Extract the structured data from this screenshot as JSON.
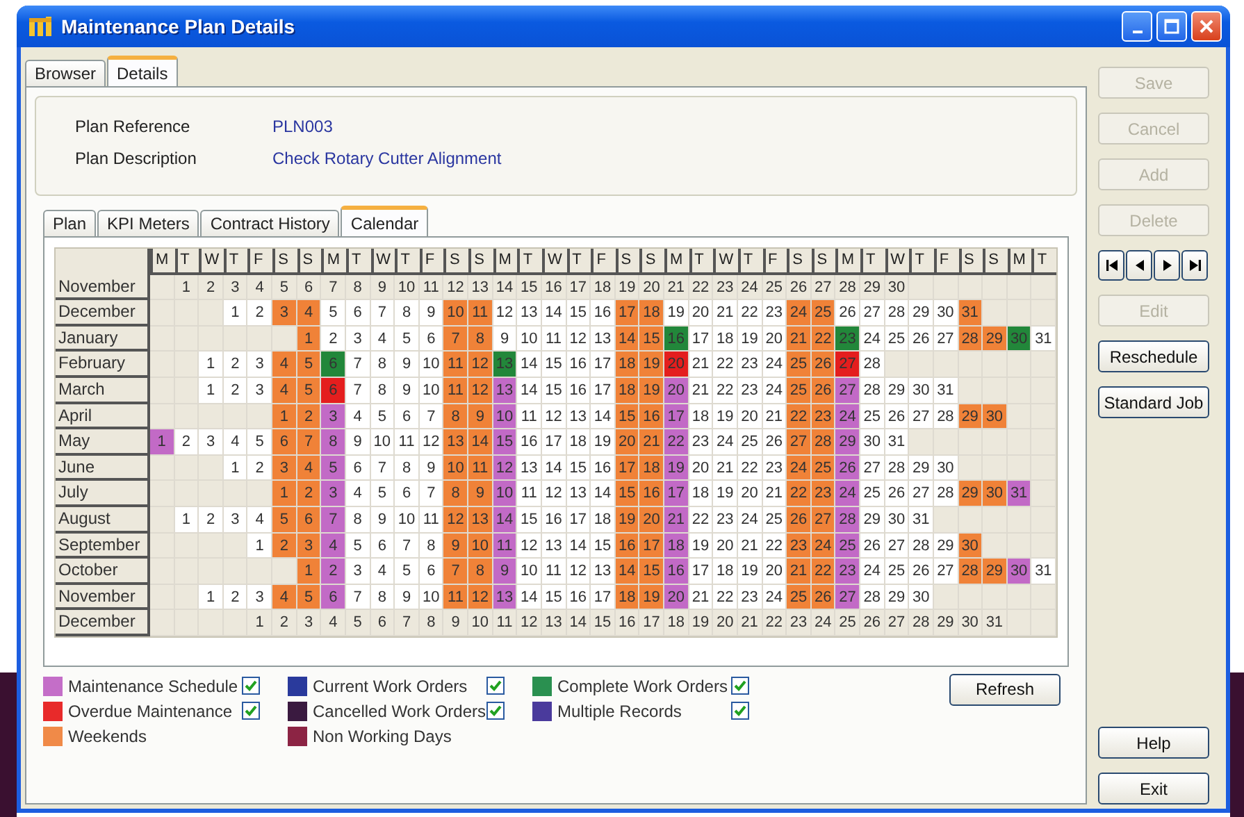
{
  "window": {
    "title": "Maintenance Plan Details"
  },
  "tabs": [
    {
      "label": "Browser",
      "selected": false
    },
    {
      "label": "Details",
      "selected": true
    }
  ],
  "fields": [
    {
      "label": "Plan Reference",
      "value": "PLN003"
    },
    {
      "label": "Plan Description",
      "value": "Check Rotary Cutter Alignment"
    }
  ],
  "sub_tabs": [
    {
      "label": "Plan",
      "selected": false
    },
    {
      "label": "KPI Meters",
      "selected": false
    },
    {
      "label": "Contract History",
      "selected": false
    },
    {
      "label": "Calendar",
      "selected": true
    }
  ],
  "calendar": {
    "weekday_headers": [
      "M",
      "T",
      "W",
      "T",
      "F",
      "S",
      "S",
      "M",
      "T",
      "W",
      "T",
      "F",
      "S",
      "S",
      "M",
      "T",
      "W",
      "T",
      "F",
      "S",
      "S",
      "M",
      "T",
      "W",
      "T",
      "F",
      "S",
      "S",
      "M",
      "T",
      "W",
      "T",
      "F",
      "S",
      "S",
      "M",
      "T"
    ],
    "months": [
      {
        "name": "November",
        "days": [
          {
            "kind": "blank"
          },
          {
            "day": "1",
            "kind": "off"
          },
          {
            "day": "2",
            "kind": "off"
          },
          {
            "day": "3",
            "kind": "off"
          },
          {
            "day": "4",
            "kind": "off"
          },
          {
            "day": "5",
            "kind": "off"
          },
          {
            "day": "6",
            "kind": "off"
          },
          {
            "day": "7",
            "kind": "off"
          },
          {
            "day": "8",
            "kind": "off"
          },
          {
            "day": "9",
            "kind": "off"
          },
          {
            "day": "10",
            "kind": "off"
          },
          {
            "day": "11",
            "kind": "off"
          },
          {
            "day": "12",
            "kind": "off"
          },
          {
            "day": "13",
            "kind": "off"
          },
          {
            "day": "14",
            "kind": "off"
          },
          {
            "day": "15",
            "kind": "off"
          },
          {
            "day": "16",
            "kind": "off"
          },
          {
            "day": "17",
            "kind": "off"
          },
          {
            "day": "18",
            "kind": "off"
          },
          {
            "day": "19",
            "kind": "off"
          },
          {
            "day": "20",
            "kind": "off"
          },
          {
            "day": "21",
            "kind": "off"
          },
          {
            "day": "22",
            "kind": "off"
          },
          {
            "day": "23",
            "kind": "off"
          },
          {
            "day": "24",
            "kind": "off"
          },
          {
            "day": "25",
            "kind": "off"
          },
          {
            "day": "26",
            "kind": "off"
          },
          {
            "day": "27",
            "kind": "off"
          },
          {
            "day": "28",
            "kind": "off"
          },
          {
            "day": "29",
            "kind": "off"
          },
          {
            "day": "30",
            "kind": "off"
          }
        ]
      },
      {
        "name": "December",
        "days": [
          {
            "kind": "blank"
          },
          {
            "kind": "blank"
          },
          {
            "kind": "blank"
          },
          {
            "day": "1",
            "kind": "plain"
          },
          {
            "day": "2",
            "kind": "plain"
          },
          {
            "day": "3",
            "kind": "weekend"
          },
          {
            "day": "4",
            "kind": "weekend"
          },
          {
            "day": "5",
            "kind": "plain"
          },
          {
            "day": "6",
            "kind": "plain"
          },
          {
            "day": "7",
            "kind": "plain"
          },
          {
            "day": "8",
            "kind": "plain"
          },
          {
            "day": "9",
            "kind": "plain"
          },
          {
            "day": "10",
            "kind": "weekend"
          },
          {
            "day": "11",
            "kind": "weekend"
          },
          {
            "day": "12",
            "kind": "plain"
          },
          {
            "day": "13",
            "kind": "plain"
          },
          {
            "day": "14",
            "kind": "plain"
          },
          {
            "day": "15",
            "kind": "plain"
          },
          {
            "day": "16",
            "kind": "plain"
          },
          {
            "day": "17",
            "kind": "weekend"
          },
          {
            "day": "18",
            "kind": "weekend"
          },
          {
            "day": "19",
            "kind": "plain"
          },
          {
            "day": "20",
            "kind": "plain"
          },
          {
            "day": "21",
            "kind": "plain"
          },
          {
            "day": "22",
            "kind": "plain"
          },
          {
            "day": "23",
            "kind": "plain"
          },
          {
            "day": "24",
            "kind": "weekend"
          },
          {
            "day": "25",
            "kind": "weekend"
          },
          {
            "day": "26",
            "kind": "plain"
          },
          {
            "day": "27",
            "kind": "plain"
          },
          {
            "day": "28",
            "kind": "plain"
          },
          {
            "day": "29",
            "kind": "plain"
          },
          {
            "day": "30",
            "kind": "plain"
          },
          {
            "day": "31",
            "kind": "weekend"
          }
        ]
      },
      {
        "name": "January",
        "days": [
          {
            "kind": "blank"
          },
          {
            "kind": "blank"
          },
          {
            "kind": "blank"
          },
          {
            "kind": "blank"
          },
          {
            "kind": "blank"
          },
          {
            "kind": "blank"
          },
          {
            "day": "1",
            "kind": "weekend"
          },
          {
            "day": "2",
            "kind": "plain"
          },
          {
            "day": "3",
            "kind": "plain"
          },
          {
            "day": "4",
            "kind": "plain"
          },
          {
            "day": "5",
            "kind": "plain"
          },
          {
            "day": "6",
            "kind": "plain"
          },
          {
            "day": "7",
            "kind": "weekend"
          },
          {
            "day": "8",
            "kind": "weekend"
          },
          {
            "day": "9",
            "kind": "plain"
          },
          {
            "day": "10",
            "kind": "plain"
          },
          {
            "day": "11",
            "kind": "plain"
          },
          {
            "day": "12",
            "kind": "plain"
          },
          {
            "day": "13",
            "kind": "plain"
          },
          {
            "day": "14",
            "kind": "weekend"
          },
          {
            "day": "15",
            "kind": "weekend"
          },
          {
            "day": "16",
            "kind": "complete"
          },
          {
            "day": "17",
            "kind": "plain"
          },
          {
            "day": "18",
            "kind": "plain"
          },
          {
            "day": "19",
            "kind": "plain"
          },
          {
            "day": "20",
            "kind": "plain"
          },
          {
            "day": "21",
            "kind": "weekend"
          },
          {
            "day": "22",
            "kind": "weekend"
          },
          {
            "day": "23",
            "kind": "complete"
          },
          {
            "day": "24",
            "kind": "plain"
          },
          {
            "day": "25",
            "kind": "plain"
          },
          {
            "day": "26",
            "kind": "plain"
          },
          {
            "day": "27",
            "kind": "plain"
          },
          {
            "day": "28",
            "kind": "weekend"
          },
          {
            "day": "29",
            "kind": "weekend"
          },
          {
            "day": "30",
            "kind": "complete"
          },
          {
            "day": "31",
            "kind": "plain"
          }
        ]
      },
      {
        "name": "February",
        "days": [
          {
            "kind": "blank"
          },
          {
            "kind": "blank"
          },
          {
            "day": "1",
            "kind": "plain"
          },
          {
            "day": "2",
            "kind": "plain"
          },
          {
            "day": "3",
            "kind": "plain"
          },
          {
            "day": "4",
            "kind": "weekend"
          },
          {
            "day": "5",
            "kind": "weekend"
          },
          {
            "day": "6",
            "kind": "complete"
          },
          {
            "day": "7",
            "kind": "plain"
          },
          {
            "day": "8",
            "kind": "plain"
          },
          {
            "day": "9",
            "kind": "plain"
          },
          {
            "day": "10",
            "kind": "plain"
          },
          {
            "day": "11",
            "kind": "weekend"
          },
          {
            "day": "12",
            "kind": "weekend"
          },
          {
            "day": "13",
            "kind": "complete"
          },
          {
            "day": "14",
            "kind": "plain"
          },
          {
            "day": "15",
            "kind": "plain"
          },
          {
            "day": "16",
            "kind": "plain"
          },
          {
            "day": "17",
            "kind": "plain"
          },
          {
            "day": "18",
            "kind": "weekend"
          },
          {
            "day": "19",
            "kind": "weekend"
          },
          {
            "day": "20",
            "kind": "overdue"
          },
          {
            "day": "21",
            "kind": "plain"
          },
          {
            "day": "22",
            "kind": "plain"
          },
          {
            "day": "23",
            "kind": "plain"
          },
          {
            "day": "24",
            "kind": "plain"
          },
          {
            "day": "25",
            "kind": "weekend"
          },
          {
            "day": "26",
            "kind": "weekend"
          },
          {
            "day": "27",
            "kind": "overdue"
          },
          {
            "day": "28",
            "kind": "plain"
          }
        ]
      },
      {
        "name": "March",
        "days": [
          {
            "kind": "blank"
          },
          {
            "kind": "blank"
          },
          {
            "day": "1",
            "kind": "plain"
          },
          {
            "day": "2",
            "kind": "plain"
          },
          {
            "day": "3",
            "kind": "plain"
          },
          {
            "day": "4",
            "kind": "weekend"
          },
          {
            "day": "5",
            "kind": "weekend"
          },
          {
            "day": "6",
            "kind": "overdue"
          },
          {
            "day": "7",
            "kind": "plain"
          },
          {
            "day": "8",
            "kind": "plain"
          },
          {
            "day": "9",
            "kind": "plain"
          },
          {
            "day": "10",
            "kind": "plain"
          },
          {
            "day": "11",
            "kind": "weekend"
          },
          {
            "day": "12",
            "kind": "weekend"
          },
          {
            "day": "13",
            "kind": "schedule"
          },
          {
            "day": "14",
            "kind": "plain"
          },
          {
            "day": "15",
            "kind": "plain"
          },
          {
            "day": "16",
            "kind": "plain"
          },
          {
            "day": "17",
            "kind": "plain"
          },
          {
            "day": "18",
            "kind": "weekend"
          },
          {
            "day": "19",
            "kind": "weekend"
          },
          {
            "day": "20",
            "kind": "schedule"
          },
          {
            "day": "21",
            "kind": "plain"
          },
          {
            "day": "22",
            "kind": "plain"
          },
          {
            "day": "23",
            "kind": "plain"
          },
          {
            "day": "24",
            "kind": "plain"
          },
          {
            "day": "25",
            "kind": "weekend"
          },
          {
            "day": "26",
            "kind": "weekend"
          },
          {
            "day": "27",
            "kind": "schedule"
          },
          {
            "day": "28",
            "kind": "plain"
          },
          {
            "day": "29",
            "kind": "plain"
          },
          {
            "day": "30",
            "kind": "plain"
          },
          {
            "day": "31",
            "kind": "plain"
          }
        ]
      },
      {
        "name": "April",
        "days": [
          {
            "kind": "blank"
          },
          {
            "kind": "blank"
          },
          {
            "kind": "blank"
          },
          {
            "kind": "blank"
          },
          {
            "kind": "blank"
          },
          {
            "day": "1",
            "kind": "weekend"
          },
          {
            "day": "2",
            "kind": "weekend"
          },
          {
            "day": "3",
            "kind": "schedule"
          },
          {
            "day": "4",
            "kind": "plain"
          },
          {
            "day": "5",
            "kind": "plain"
          },
          {
            "day": "6",
            "kind": "plain"
          },
          {
            "day": "7",
            "kind": "plain"
          },
          {
            "day": "8",
            "kind": "weekend"
          },
          {
            "day": "9",
            "kind": "weekend"
          },
          {
            "day": "10",
            "kind": "schedule"
          },
          {
            "day": "11",
            "kind": "plain"
          },
          {
            "day": "12",
            "kind": "plain"
          },
          {
            "day": "13",
            "kind": "plain"
          },
          {
            "day": "14",
            "kind": "plain"
          },
          {
            "day": "15",
            "kind": "weekend"
          },
          {
            "day": "16",
            "kind": "weekend"
          },
          {
            "day": "17",
            "kind": "schedule"
          },
          {
            "day": "18",
            "kind": "plain"
          },
          {
            "day": "19",
            "kind": "plain"
          },
          {
            "day": "20",
            "kind": "plain"
          },
          {
            "day": "21",
            "kind": "plain"
          },
          {
            "day": "22",
            "kind": "weekend"
          },
          {
            "day": "23",
            "kind": "weekend"
          },
          {
            "day": "24",
            "kind": "schedule"
          },
          {
            "day": "25",
            "kind": "plain"
          },
          {
            "day": "26",
            "kind": "plain"
          },
          {
            "day": "27",
            "kind": "plain"
          },
          {
            "day": "28",
            "kind": "plain"
          },
          {
            "day": "29",
            "kind": "weekend"
          },
          {
            "day": "30",
            "kind": "weekend"
          }
        ]
      },
      {
        "name": "May",
        "days": [
          {
            "day": "1",
            "kind": "schedule"
          },
          {
            "day": "2",
            "kind": "plain"
          },
          {
            "day": "3",
            "kind": "plain"
          },
          {
            "day": "4",
            "kind": "plain"
          },
          {
            "day": "5",
            "kind": "plain"
          },
          {
            "day": "6",
            "kind": "weekend"
          },
          {
            "day": "7",
            "kind": "weekend"
          },
          {
            "day": "8",
            "kind": "schedule"
          },
          {
            "day": "9",
            "kind": "plain"
          },
          {
            "day": "10",
            "kind": "plain"
          },
          {
            "day": "11",
            "kind": "plain"
          },
          {
            "day": "12",
            "kind": "plain"
          },
          {
            "day": "13",
            "kind": "weekend"
          },
          {
            "day": "14",
            "kind": "weekend"
          },
          {
            "day": "15",
            "kind": "schedule"
          },
          {
            "day": "16",
            "kind": "plain"
          },
          {
            "day": "17",
            "kind": "plain"
          },
          {
            "day": "18",
            "kind": "plain"
          },
          {
            "day": "19",
            "kind": "plain"
          },
          {
            "day": "20",
            "kind": "weekend"
          },
          {
            "day": "21",
            "kind": "weekend"
          },
          {
            "day": "22",
            "kind": "schedule"
          },
          {
            "day": "23",
            "kind": "plain"
          },
          {
            "day": "24",
            "kind": "plain"
          },
          {
            "day": "25",
            "kind": "plain"
          },
          {
            "day": "26",
            "kind": "plain"
          },
          {
            "day": "27",
            "kind": "weekend"
          },
          {
            "day": "28",
            "kind": "weekend"
          },
          {
            "day": "29",
            "kind": "schedule"
          },
          {
            "day": "30",
            "kind": "plain"
          },
          {
            "day": "31",
            "kind": "plain"
          }
        ]
      },
      {
        "name": "June",
        "days": [
          {
            "kind": "blank"
          },
          {
            "kind": "blank"
          },
          {
            "kind": "blank"
          },
          {
            "day": "1",
            "kind": "plain"
          },
          {
            "day": "2",
            "kind": "plain"
          },
          {
            "day": "3",
            "kind": "weekend"
          },
          {
            "day": "4",
            "kind": "weekend"
          },
          {
            "day": "5",
            "kind": "schedule"
          },
          {
            "day": "6",
            "kind": "plain"
          },
          {
            "day": "7",
            "kind": "plain"
          },
          {
            "day": "8",
            "kind": "plain"
          },
          {
            "day": "9",
            "kind": "plain"
          },
          {
            "day": "10",
            "kind": "weekend"
          },
          {
            "day": "11",
            "kind": "weekend"
          },
          {
            "day": "12",
            "kind": "schedule"
          },
          {
            "day": "13",
            "kind": "plain"
          },
          {
            "day": "14",
            "kind": "plain"
          },
          {
            "day": "15",
            "kind": "plain"
          },
          {
            "day": "16",
            "kind": "plain"
          },
          {
            "day": "17",
            "kind": "weekend"
          },
          {
            "day": "18",
            "kind": "weekend"
          },
          {
            "day": "19",
            "kind": "schedule"
          },
          {
            "day": "20",
            "kind": "plain"
          },
          {
            "day": "21",
            "kind": "plain"
          },
          {
            "day": "22",
            "kind": "plain"
          },
          {
            "day": "23",
            "kind": "plain"
          },
          {
            "day": "24",
            "kind": "weekend"
          },
          {
            "day": "25",
            "kind": "weekend"
          },
          {
            "day": "26",
            "kind": "schedule"
          },
          {
            "day": "27",
            "kind": "plain"
          },
          {
            "day": "28",
            "kind": "plain"
          },
          {
            "day": "29",
            "kind": "plain"
          },
          {
            "day": "30",
            "kind": "plain"
          }
        ]
      },
      {
        "name": "July",
        "days": [
          {
            "kind": "blank"
          },
          {
            "kind": "blank"
          },
          {
            "kind": "blank"
          },
          {
            "kind": "blank"
          },
          {
            "kind": "blank"
          },
          {
            "day": "1",
            "kind": "weekend"
          },
          {
            "day": "2",
            "kind": "weekend"
          },
          {
            "day": "3",
            "kind": "schedule"
          },
          {
            "day": "4",
            "kind": "plain"
          },
          {
            "day": "5",
            "kind": "plain"
          },
          {
            "day": "6",
            "kind": "plain"
          },
          {
            "day": "7",
            "kind": "plain"
          },
          {
            "day": "8",
            "kind": "weekend"
          },
          {
            "day": "9",
            "kind": "weekend"
          },
          {
            "day": "10",
            "kind": "schedule"
          },
          {
            "day": "11",
            "kind": "plain"
          },
          {
            "day": "12",
            "kind": "plain"
          },
          {
            "day": "13",
            "kind": "plain"
          },
          {
            "day": "14",
            "kind": "plain"
          },
          {
            "day": "15",
            "kind": "weekend"
          },
          {
            "day": "16",
            "kind": "weekend"
          },
          {
            "day": "17",
            "kind": "schedule"
          },
          {
            "day": "18",
            "kind": "plain"
          },
          {
            "day": "19",
            "kind": "plain"
          },
          {
            "day": "20",
            "kind": "plain"
          },
          {
            "day": "21",
            "kind": "plain"
          },
          {
            "day": "22",
            "kind": "weekend"
          },
          {
            "day": "23",
            "kind": "weekend"
          },
          {
            "day": "24",
            "kind": "schedule"
          },
          {
            "day": "25",
            "kind": "plain"
          },
          {
            "day": "26",
            "kind": "plain"
          },
          {
            "day": "27",
            "kind": "plain"
          },
          {
            "day": "28",
            "kind": "plain"
          },
          {
            "day": "29",
            "kind": "weekend"
          },
          {
            "day": "30",
            "kind": "weekend"
          },
          {
            "day": "31",
            "kind": "schedule"
          }
        ]
      },
      {
        "name": "August",
        "days": [
          {
            "kind": "blank"
          },
          {
            "day": "1",
            "kind": "plain"
          },
          {
            "day": "2",
            "kind": "plain"
          },
          {
            "day": "3",
            "kind": "plain"
          },
          {
            "day": "4",
            "kind": "plain"
          },
          {
            "day": "5",
            "kind": "weekend"
          },
          {
            "day": "6",
            "kind": "weekend"
          },
          {
            "day": "7",
            "kind": "schedule"
          },
          {
            "day": "8",
            "kind": "plain"
          },
          {
            "day": "9",
            "kind": "plain"
          },
          {
            "day": "10",
            "kind": "plain"
          },
          {
            "day": "11",
            "kind": "plain"
          },
          {
            "day": "12",
            "kind": "weekend"
          },
          {
            "day": "13",
            "kind": "weekend"
          },
          {
            "day": "14",
            "kind": "schedule"
          },
          {
            "day": "15",
            "kind": "plain"
          },
          {
            "day": "16",
            "kind": "plain"
          },
          {
            "day": "17",
            "kind": "plain"
          },
          {
            "day": "18",
            "kind": "plain"
          },
          {
            "day": "19",
            "kind": "weekend"
          },
          {
            "day": "20",
            "kind": "weekend"
          },
          {
            "day": "21",
            "kind": "schedule"
          },
          {
            "day": "22",
            "kind": "plain"
          },
          {
            "day": "23",
            "kind": "plain"
          },
          {
            "day": "24",
            "kind": "plain"
          },
          {
            "day": "25",
            "kind": "plain"
          },
          {
            "day": "26",
            "kind": "weekend"
          },
          {
            "day": "27",
            "kind": "weekend"
          },
          {
            "day": "28",
            "kind": "schedule"
          },
          {
            "day": "29",
            "kind": "plain"
          },
          {
            "day": "30",
            "kind": "plain"
          },
          {
            "day": "31",
            "kind": "plain"
          }
        ]
      },
      {
        "name": "September",
        "days": [
          {
            "kind": "blank"
          },
          {
            "kind": "blank"
          },
          {
            "kind": "blank"
          },
          {
            "kind": "blank"
          },
          {
            "day": "1",
            "kind": "plain"
          },
          {
            "day": "2",
            "kind": "weekend"
          },
          {
            "day": "3",
            "kind": "weekend"
          },
          {
            "day": "4",
            "kind": "schedule"
          },
          {
            "day": "5",
            "kind": "plain"
          },
          {
            "day": "6",
            "kind": "plain"
          },
          {
            "day": "7",
            "kind": "plain"
          },
          {
            "day": "8",
            "kind": "plain"
          },
          {
            "day": "9",
            "kind": "weekend"
          },
          {
            "day": "10",
            "kind": "weekend"
          },
          {
            "day": "11",
            "kind": "schedule"
          },
          {
            "day": "12",
            "kind": "plain"
          },
          {
            "day": "13",
            "kind": "plain"
          },
          {
            "day": "14",
            "kind": "plain"
          },
          {
            "day": "15",
            "kind": "plain"
          },
          {
            "day": "16",
            "kind": "weekend"
          },
          {
            "day": "17",
            "kind": "weekend"
          },
          {
            "day": "18",
            "kind": "schedule"
          },
          {
            "day": "19",
            "kind": "plain"
          },
          {
            "day": "20",
            "kind": "plain"
          },
          {
            "day": "21",
            "kind": "plain"
          },
          {
            "day": "22",
            "kind": "plain"
          },
          {
            "day": "23",
            "kind": "weekend"
          },
          {
            "day": "24",
            "kind": "weekend"
          },
          {
            "day": "25",
            "kind": "schedule"
          },
          {
            "day": "26",
            "kind": "plain"
          },
          {
            "day": "27",
            "kind": "plain"
          },
          {
            "day": "28",
            "kind": "plain"
          },
          {
            "day": "29",
            "kind": "plain"
          },
          {
            "day": "30",
            "kind": "weekend"
          }
        ]
      },
      {
        "name": "October",
        "days": [
          {
            "kind": "blank"
          },
          {
            "kind": "blank"
          },
          {
            "kind": "blank"
          },
          {
            "kind": "blank"
          },
          {
            "kind": "blank"
          },
          {
            "kind": "blank"
          },
          {
            "day": "1",
            "kind": "weekend"
          },
          {
            "day": "2",
            "kind": "schedule"
          },
          {
            "day": "3",
            "kind": "plain"
          },
          {
            "day": "4",
            "kind": "plain"
          },
          {
            "day": "5",
            "kind": "plain"
          },
          {
            "day": "6",
            "kind": "plain"
          },
          {
            "day": "7",
            "kind": "weekend"
          },
          {
            "day": "8",
            "kind": "weekend"
          },
          {
            "day": "9",
            "kind": "schedule"
          },
          {
            "day": "10",
            "kind": "plain"
          },
          {
            "day": "11",
            "kind": "plain"
          },
          {
            "day": "12",
            "kind": "plain"
          },
          {
            "day": "13",
            "kind": "plain"
          },
          {
            "day": "14",
            "kind": "weekend"
          },
          {
            "day": "15",
            "kind": "weekend"
          },
          {
            "day": "16",
            "kind": "schedule"
          },
          {
            "day": "17",
            "kind": "plain"
          },
          {
            "day": "18",
            "kind": "plain"
          },
          {
            "day": "19",
            "kind": "plain"
          },
          {
            "day": "20",
            "kind": "plain"
          },
          {
            "day": "21",
            "kind": "weekend"
          },
          {
            "day": "22",
            "kind": "weekend"
          },
          {
            "day": "23",
            "kind": "schedule"
          },
          {
            "day": "24",
            "kind": "plain"
          },
          {
            "day": "25",
            "kind": "plain"
          },
          {
            "day": "26",
            "kind": "plain"
          },
          {
            "day": "27",
            "kind": "plain"
          },
          {
            "day": "28",
            "kind": "weekend"
          },
          {
            "day": "29",
            "kind": "weekend"
          },
          {
            "day": "30",
            "kind": "schedule"
          },
          {
            "day": "31",
            "kind": "plain"
          }
        ]
      },
      {
        "name": "November",
        "days": [
          {
            "kind": "blank"
          },
          {
            "kind": "blank"
          },
          {
            "day": "1",
            "kind": "plain"
          },
          {
            "day": "2",
            "kind": "plain"
          },
          {
            "day": "3",
            "kind": "plain"
          },
          {
            "day": "4",
            "kind": "weekend"
          },
          {
            "day": "5",
            "kind": "weekend"
          },
          {
            "day": "6",
            "kind": "schedule"
          },
          {
            "day": "7",
            "kind": "plain"
          },
          {
            "day": "8",
            "kind": "plain"
          },
          {
            "day": "9",
            "kind": "plain"
          },
          {
            "day": "10",
            "kind": "plain"
          },
          {
            "day": "11",
            "kind": "weekend"
          },
          {
            "day": "12",
            "kind": "weekend"
          },
          {
            "day": "13",
            "kind": "schedule"
          },
          {
            "day": "14",
            "kind": "plain"
          },
          {
            "day": "15",
            "kind": "plain"
          },
          {
            "day": "16",
            "kind": "plain"
          },
          {
            "day": "17",
            "kind": "plain"
          },
          {
            "day": "18",
            "kind": "weekend"
          },
          {
            "day": "19",
            "kind": "weekend"
          },
          {
            "day": "20",
            "kind": "schedule"
          },
          {
            "day": "21",
            "kind": "plain"
          },
          {
            "day": "22",
            "kind": "plain"
          },
          {
            "day": "23",
            "kind": "plain"
          },
          {
            "day": "24",
            "kind": "plain"
          },
          {
            "day": "25",
            "kind": "weekend"
          },
          {
            "day": "26",
            "kind": "weekend"
          },
          {
            "day": "27",
            "kind": "schedule"
          },
          {
            "day": "28",
            "kind": "plain"
          },
          {
            "day": "29",
            "kind": "plain"
          },
          {
            "day": "30",
            "kind": "plain"
          }
        ]
      },
      {
        "name": "December",
        "days": [
          {
            "kind": "blank"
          },
          {
            "kind": "blank"
          },
          {
            "kind": "blank"
          },
          {
            "kind": "blank"
          },
          {
            "day": "1",
            "kind": "off"
          },
          {
            "day": "2",
            "kind": "off"
          },
          {
            "day": "3",
            "kind": "off"
          },
          {
            "day": "4",
            "kind": "off"
          },
          {
            "day": "5",
            "kind": "off"
          },
          {
            "day": "6",
            "kind": "off"
          },
          {
            "day": "7",
            "kind": "off"
          },
          {
            "day": "8",
            "kind": "off"
          },
          {
            "day": "9",
            "kind": "off"
          },
          {
            "day": "10",
            "kind": "off"
          },
          {
            "day": "11",
            "kind": "off"
          },
          {
            "day": "12",
            "kind": "off"
          },
          {
            "day": "13",
            "kind": "off"
          },
          {
            "day": "14",
            "kind": "off"
          },
          {
            "day": "15",
            "kind": "off"
          },
          {
            "day": "16",
            "kind": "off"
          },
          {
            "day": "17",
            "kind": "off"
          },
          {
            "day": "18",
            "kind": "off"
          },
          {
            "day": "19",
            "kind": "off"
          },
          {
            "day": "20",
            "kind": "off"
          },
          {
            "day": "21",
            "kind": "off"
          },
          {
            "day": "22",
            "kind": "off"
          },
          {
            "day": "23",
            "kind": "off"
          },
          {
            "day": "24",
            "kind": "off"
          },
          {
            "day": "25",
            "kind": "off"
          },
          {
            "day": "26",
            "kind": "off"
          },
          {
            "day": "27",
            "kind": "off"
          },
          {
            "day": "28",
            "kind": "off"
          },
          {
            "day": "29",
            "kind": "off"
          },
          {
            "day": "30",
            "kind": "off"
          },
          {
            "day": "31",
            "kind": "off"
          }
        ]
      }
    ]
  },
  "legend": [
    {
      "label": "Maintenance Schedule",
      "color": "#c46ec8",
      "kind": "toggle",
      "checked": true
    },
    {
      "label": "Overdue Maintenance",
      "color": "#e82a2a",
      "kind": "toggle",
      "checked": true
    },
    {
      "label": "Weekends",
      "color": "#f08a48",
      "kind": "static"
    },
    {
      "label": "Current Work Orders",
      "color": "#2a3a9c",
      "kind": "toggle",
      "checked": true
    },
    {
      "label": "Cancelled Work Orders",
      "color": "#3a1a40",
      "kind": "toggle",
      "checked": true
    },
    {
      "label": "Non Working Days",
      "color": "#8c2444",
      "kind": "static"
    },
    {
      "label": "Complete Work Orders",
      "color": "#2a9050",
      "kind": "toggle",
      "checked": true
    },
    {
      "label": "Multiple Records",
      "color": "#4a3a9c",
      "kind": "toggle",
      "checked": true
    }
  ],
  "refresh_button": "Refresh",
  "side_buttons": [
    {
      "label": "Save",
      "disabled": true
    },
    {
      "label": "Cancel",
      "disabled": true
    },
    {
      "label": "Add",
      "disabled": true
    },
    {
      "label": "Delete",
      "disabled": true
    },
    {
      "kind": "nav"
    },
    {
      "label": "Edit",
      "disabled": true
    },
    {
      "label": "Reschedule",
      "disabled": false
    },
    {
      "label": "Standard Job",
      "disabled": false
    }
  ],
  "bottom_buttons": [
    {
      "label": "Help"
    },
    {
      "label": "Exit"
    }
  ]
}
